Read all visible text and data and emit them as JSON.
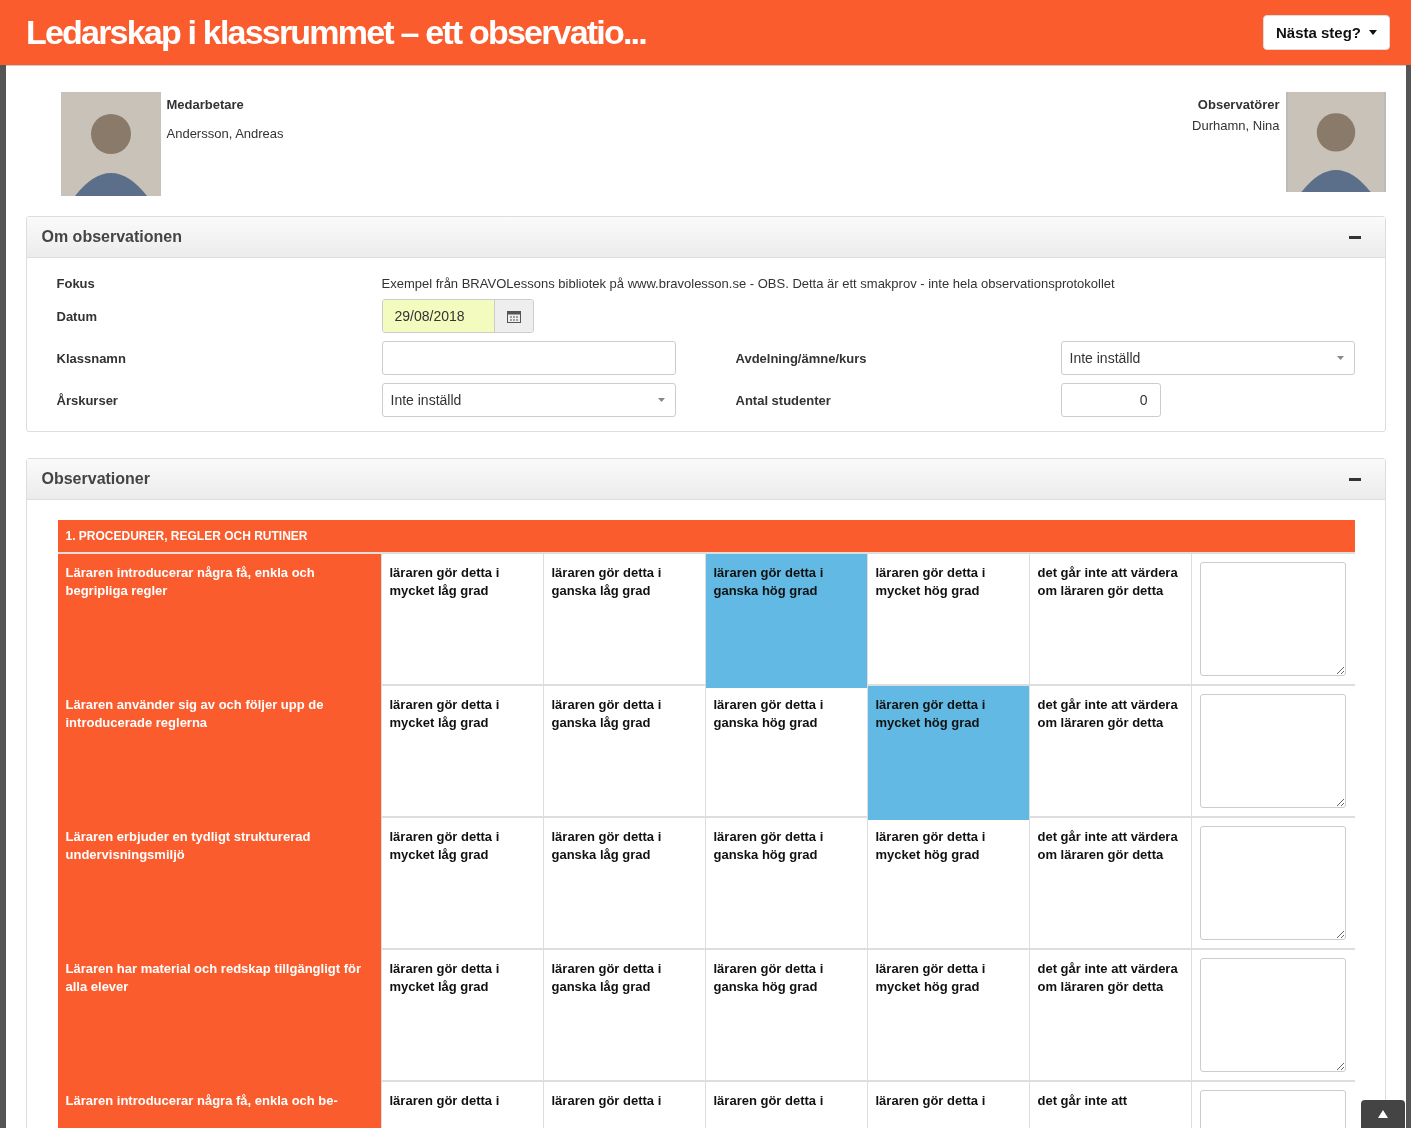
{
  "header": {
    "title": "Ledarskap i klassrummet – ett observatio...",
    "next_button": "Nästa steg?"
  },
  "people": {
    "employee": {
      "label": "Medarbetare",
      "name": "Andersson, Andreas"
    },
    "observer": {
      "label": "Observatörer",
      "name": "Durhamn, Nina"
    }
  },
  "about_panel": {
    "title": "Om observationen",
    "expanded": true,
    "focus": {
      "label": "Fokus",
      "value": "Exempel från BRAVOLessons bibliotek på www.bravolesson.se - OBS. Detta är ett smakprov - inte hela observationsprotokollet"
    },
    "date": {
      "label": "Datum",
      "value": "29/08/2018"
    },
    "class_name": {
      "label": "Klassnamn"
    },
    "department": {
      "label": "Avdelning/ämne/kurs",
      "value": "Inte inställd"
    },
    "grades": {
      "label": "Årskurser",
      "value": "Inte inställd"
    },
    "students": {
      "label": "Antal studenter",
      "value": "0"
    }
  },
  "observations_panel": {
    "title": "Observationer",
    "expanded": true,
    "section_title": "1. PROCEDURER, REGLER OCH RUTINER",
    "rows": [
      {
        "criterion": "Läraren introducerar några få, enkla och begripliga regler",
        "options": [
          {
            "label": "läraren gör detta i mycket låg grad",
            "selected": false
          },
          {
            "label": "läraren gör detta i ganska låg grad",
            "selected": false
          },
          {
            "label": "läraren gör detta i ganska hög grad",
            "selected": true
          },
          {
            "label": "läraren gör detta i mycket hög grad",
            "selected": false
          },
          {
            "label": "det går inte att värdera om läraren gör detta",
            "selected": false
          }
        ]
      },
      {
        "criterion": "Läraren använder sig av och följer upp de introducerade reglerna",
        "options": [
          {
            "label": "läraren gör detta i mycket låg grad",
            "selected": false
          },
          {
            "label": "läraren gör detta i ganska låg grad",
            "selected": false
          },
          {
            "label": "läraren gör detta i ganska hög grad",
            "selected": false
          },
          {
            "label": "läraren gör detta i mycket hög grad",
            "selected": true
          },
          {
            "label": "det går inte att värdera om läraren gör detta",
            "selected": false
          }
        ]
      },
      {
        "criterion": "Läraren erbjuder en tydligt strukturerad undervisningsmiljö",
        "options": [
          {
            "label": "läraren gör detta i mycket låg grad",
            "selected": false
          },
          {
            "label": "läraren gör detta i ganska låg grad",
            "selected": false
          },
          {
            "label": "läraren gör detta i ganska hög grad",
            "selected": false
          },
          {
            "label": "läraren gör detta i mycket hög grad",
            "selected": false
          },
          {
            "label": "det går inte att värdera om läraren gör detta",
            "selected": false
          }
        ]
      },
      {
        "criterion": "Läraren har material och redskap tillgängligt för alla elever",
        "options": [
          {
            "label": "läraren gör detta i mycket låg grad",
            "selected": false
          },
          {
            "label": "läraren gör detta i ganska låg grad",
            "selected": false
          },
          {
            "label": "läraren gör detta i ganska hög grad",
            "selected": false
          },
          {
            "label": "läraren gör detta i mycket hög grad",
            "selected": false
          },
          {
            "label": "det går inte att värdera om läraren gör detta",
            "selected": false
          }
        ]
      },
      {
        "criterion": "Läraren introducerar några få, enkla och be-",
        "options": [
          {
            "label": "läraren gör detta i",
            "selected": false
          },
          {
            "label": "läraren gör detta i",
            "selected": false
          },
          {
            "label": "läraren gör detta i",
            "selected": false
          },
          {
            "label": "läraren gör detta i",
            "selected": false
          },
          {
            "label": "det går inte att",
            "selected": false
          }
        ]
      }
    ]
  }
}
